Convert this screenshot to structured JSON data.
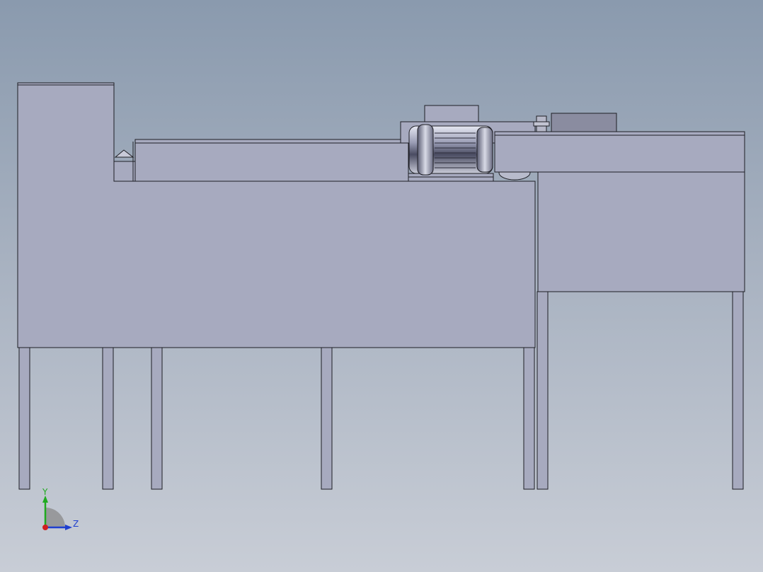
{
  "viewport": {
    "background_top": "#8a9aae",
    "background_bottom": "#c8cdd6",
    "body_fill": "#a7aabf",
    "edge_color": "#1e1e24"
  },
  "triad": {
    "x_label": "",
    "y_label": "Y",
    "z_label": "Z",
    "y_color": "#1faa1f",
    "z_color": "#1f3fcf",
    "x_color": "#d01f1f"
  }
}
